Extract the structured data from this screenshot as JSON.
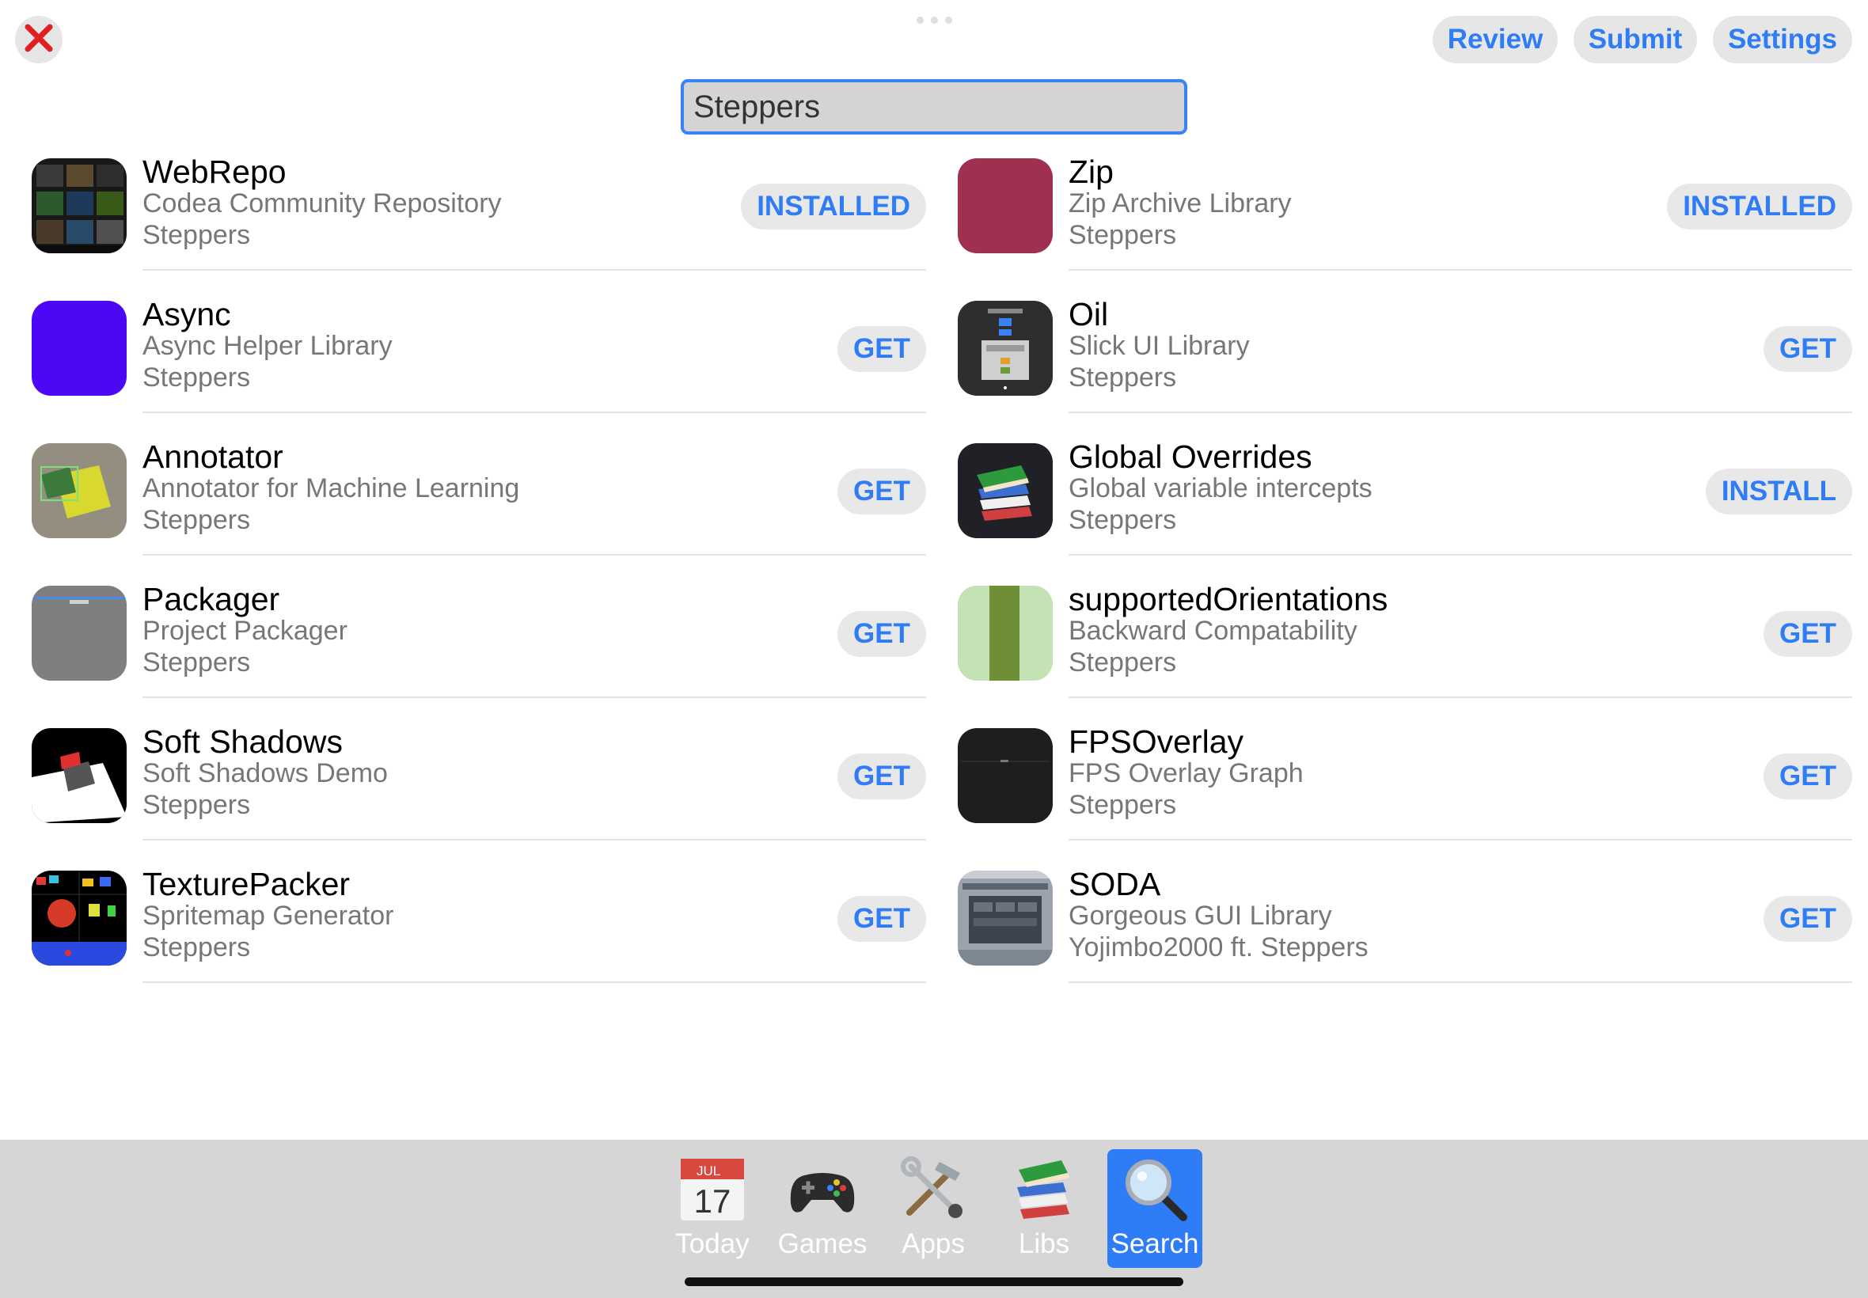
{
  "header": {
    "review_label": "Review",
    "submit_label": "Submit",
    "settings_label": "Settings"
  },
  "search": {
    "value": "Steppers",
    "placeholder": ""
  },
  "results": [
    {
      "title": "WebRepo",
      "subtitle": "Codea Community Repository",
      "author": "Steppers",
      "action": "INSTALLED",
      "icon": "webrepo-screenshot-icon"
    },
    {
      "title": "Zip",
      "subtitle": "Zip Archive Library",
      "author": "Steppers",
      "action": "INSTALLED",
      "icon": "zip-icon"
    },
    {
      "title": "Async",
      "subtitle": "Async Helper Library",
      "author": "Steppers",
      "action": "GET",
      "icon": "async-icon"
    },
    {
      "title": "Oil",
      "subtitle": "Slick UI Library",
      "author": "Steppers",
      "action": "GET",
      "icon": "oil-icon"
    },
    {
      "title": "Annotator",
      "subtitle": "Annotator for Machine Learning",
      "author": "Steppers",
      "action": "GET",
      "icon": "annotator-icon"
    },
    {
      "title": "Global Overrides",
      "subtitle": "Global variable intercepts",
      "author": "Steppers",
      "action": "INSTALL",
      "icon": "books-icon"
    },
    {
      "title": "Packager",
      "subtitle": "Project Packager",
      "author": "Steppers",
      "action": "GET",
      "icon": "packager-icon"
    },
    {
      "title": "supportedOrientations",
      "subtitle": "Backward Compatability",
      "author": "Steppers",
      "action": "GET",
      "icon": "supported-orientations-icon"
    },
    {
      "title": "Soft Shadows",
      "subtitle": "Soft Shadows Demo",
      "author": "Steppers",
      "action": "GET",
      "icon": "soft-shadows-icon"
    },
    {
      "title": "FPSOverlay",
      "subtitle": "FPS Overlay Graph",
      "author": "Steppers",
      "action": "GET",
      "icon": "fps-overlay-icon"
    },
    {
      "title": "TexturePacker",
      "subtitle": "Spritemap Generator",
      "author": "Steppers",
      "action": "GET",
      "icon": "texture-packer-icon"
    },
    {
      "title": "SODA",
      "subtitle": "Gorgeous GUI Library",
      "author": "Yojimbo2000 ft.  Steppers",
      "action": "GET",
      "icon": "soda-icon"
    }
  ],
  "tabs": [
    {
      "label": "Today",
      "icon": "calendar-icon",
      "calendar_month": "JUL",
      "calendar_day": "17",
      "active": false
    },
    {
      "label": "Games",
      "icon": "gamepad-icon",
      "active": false
    },
    {
      "label": "Apps",
      "icon": "tools-icon",
      "active": false
    },
    {
      "label": "Libs",
      "icon": "books-icon",
      "active": false
    },
    {
      "label": "Search",
      "icon": "magnifier-icon",
      "active": true
    }
  ],
  "colors": {
    "accent": "#2e7cf6",
    "close_x": "#e02020",
    "tab_bar_bg": "#d6d6d6",
    "pill_bg": "#e8e8e8",
    "zip_icon": "#a03050",
    "async_icon": "#4a08f5"
  }
}
